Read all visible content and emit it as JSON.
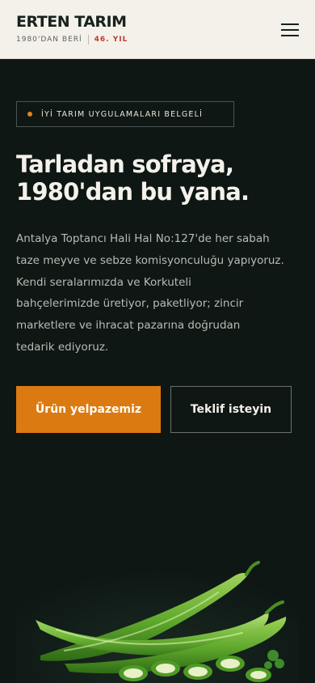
{
  "header": {
    "brand_name": "ERTEN TARIM",
    "since": "1980'DAN BERİ",
    "years": "46. YIL",
    "menu_icon": "hamburger-menu-icon"
  },
  "hero": {
    "badge": "İYİ TARIM UYGULAMALARI BELGELİ",
    "title_lines": [
      "Tarladan sofraya,",
      "1980'dan bu yana."
    ],
    "description_lines": [
      "Antalya Toptancı Hali Hal No:127'de her sabah",
      "taze meyve ve sebze komisyonculuğu yapıyoruz.",
      "Kendi seralarımızda ve Korkuteli",
      "bahçelerimizde üretiyor, paketliyor; zincir",
      "marketlere ve ihracat pazarına doğrudan",
      "tedarik ediyoruz."
    ],
    "primary_button": "Ürün yelpazemiz",
    "secondary_button": "Teklif isteyin",
    "image": "green-peppers-illustration"
  },
  "colors": {
    "header_bg": "#f4f1ea",
    "page_bg": "#0e1714",
    "accent": "#dc7a12",
    "badge_dot": "#e0861a",
    "years_red": "#c0392b"
  }
}
